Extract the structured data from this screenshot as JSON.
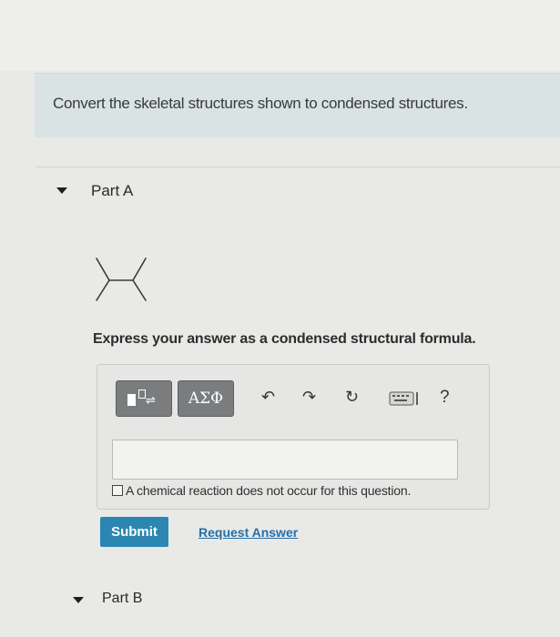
{
  "question": {
    "text": "Convert the skeletal structures shown to condensed structures."
  },
  "part_a": {
    "label": "Part A",
    "caret_icon": "caret-down-icon",
    "molecule_icon": "skeletal-structure-2-3-dimethylbutane",
    "instruction": "Express your answer as a condensed structural formula.",
    "toolbar": {
      "templates_icon": "templates-icon",
      "symbols_label": "ΑΣΦ",
      "undo_icon": "undo-icon",
      "redo_icon": "redo-icon",
      "reset_icon": "reset-icon",
      "keyboard_icon": "keyboard-icon",
      "help_label": "?"
    },
    "answer_input": {
      "value": "",
      "placeholder": ""
    },
    "no_reaction_checkbox": {
      "checked": false,
      "label": "A chemical reaction does not occur for this question."
    },
    "submit_label": "Submit",
    "request_answer_label": "Request Answer"
  },
  "part_b": {
    "label": "Part B",
    "caret_icon": "caret-down-icon"
  }
}
